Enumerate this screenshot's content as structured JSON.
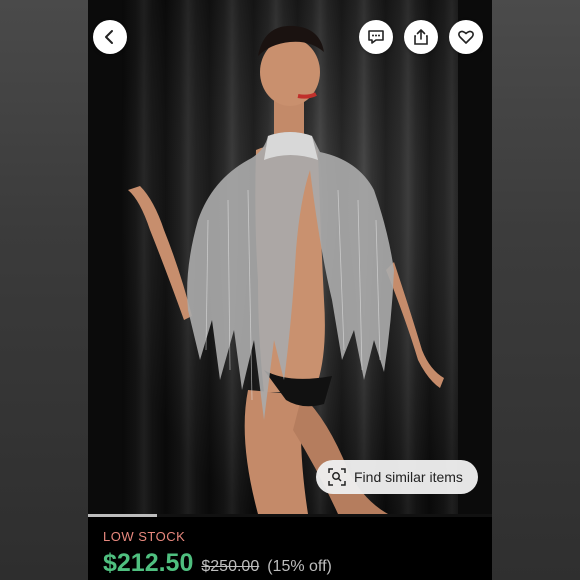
{
  "listing": {
    "stock_status": "LOW STOCK",
    "price": "$212.50",
    "original_price": "$250.00",
    "discount": "(15% off)"
  },
  "actions": {
    "back_icon": "chevron-left-icon",
    "comment_icon": "comment-icon",
    "share_icon": "share-icon",
    "like_icon": "heart-icon",
    "find_similar_label": "Find similar items",
    "find_similar_icon": "scan-search-icon"
  },
  "gallery": {
    "current_image": 1,
    "image_progress_fraction": 0.17
  },
  "colors": {
    "price_green": "#4fbf7f",
    "low_stock_red": "#e8887e",
    "background": "#000000"
  }
}
